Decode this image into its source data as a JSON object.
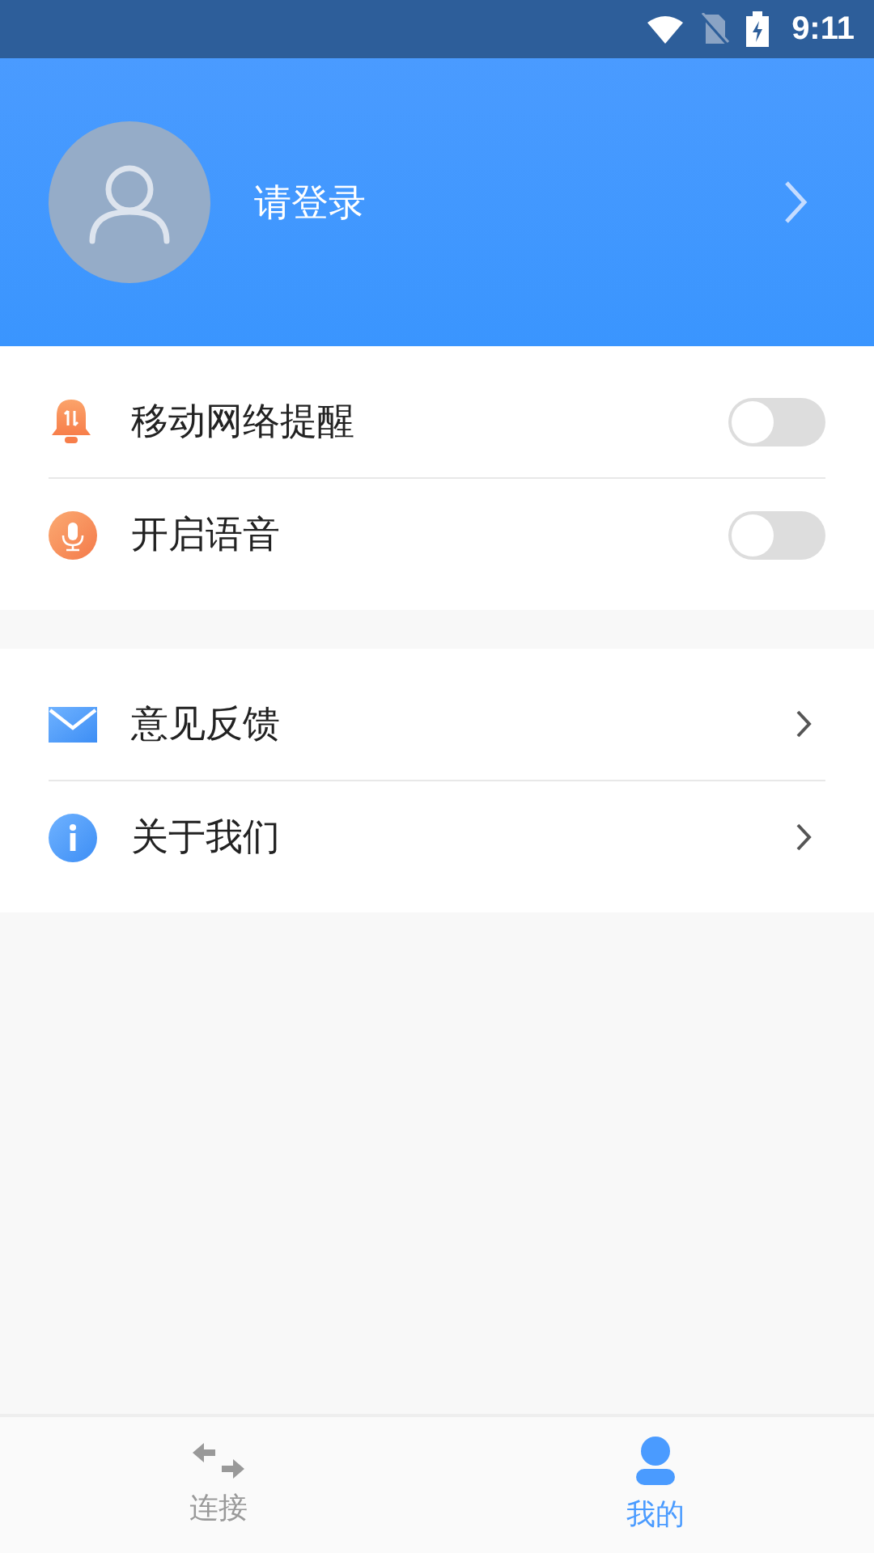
{
  "status_bar": {
    "time": "9:11"
  },
  "profile": {
    "login_label": "请登录"
  },
  "sections": [
    {
      "items": [
        {
          "kind": "toggle",
          "label": "移动网络提醒",
          "on": false
        },
        {
          "kind": "toggle",
          "label": "开启语音",
          "on": false
        }
      ]
    },
    {
      "items": [
        {
          "kind": "link",
          "label": "意见反馈"
        },
        {
          "kind": "link",
          "label": "关于我们"
        }
      ]
    }
  ],
  "tabs": [
    {
      "label": "连接",
      "selected": false
    },
    {
      "label": "我的",
      "selected": true
    }
  ]
}
